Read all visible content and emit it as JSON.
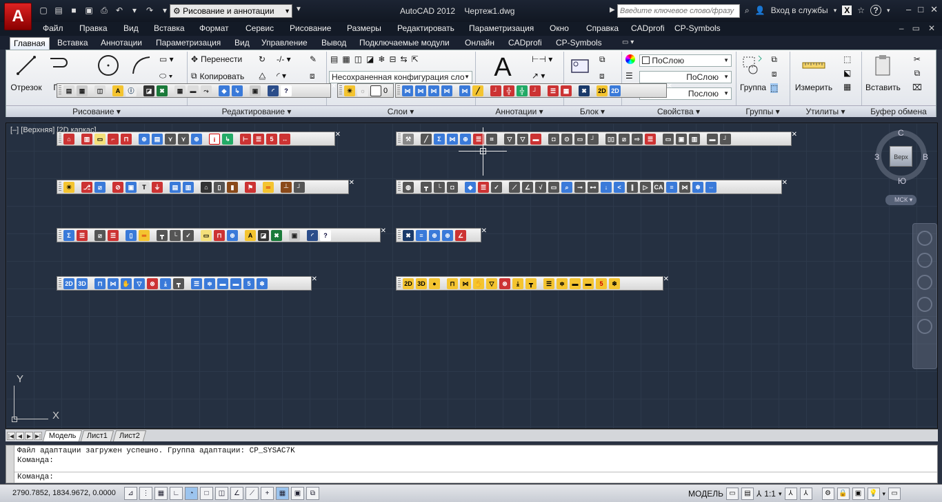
{
  "titlebar": {
    "app_letter": "A",
    "workspace": "Рисование и аннотации",
    "app_title": "AutoCAD 2012",
    "doc_title": "Чертеж1.dwg",
    "search_placeholder": "Введите ключевое слово/фразу",
    "signin": "Вход в службы",
    "help": "?",
    "min": "–",
    "max": "□",
    "close": "✕"
  },
  "menu": [
    "Файл",
    "Правка",
    "Вид",
    "Вставка",
    "Формат",
    "Сервис",
    "Рисование",
    "Размеры",
    "Редактировать",
    "Параметризация",
    "Окно",
    "Справка",
    "CADprofi",
    "CP-Symbols"
  ],
  "ribbon_tabs": [
    "Главная",
    "Вставка",
    "Аннотации",
    "Параметризация",
    "Вид",
    "Управление",
    "Вывод",
    "Подключаемые модули",
    "Онлайн",
    "CADprofi",
    "CP-Symbols"
  ],
  "ribbon": {
    "draw_line": "Отрезок",
    "draw_poly": "По",
    "modify_move": "Перенести",
    "modify_copy": "Копировать",
    "layer_state": "Несохраненная конфигурация сло",
    "text_big": "A",
    "layer_num": "0",
    "prop_color": "ПоСлою",
    "prop_linetype": "ПоСлою",
    "prop_lineweight": "Послою",
    "group": "Группа",
    "measure": "Измерить",
    "paste": "Вставить",
    "panels": [
      "Рисование",
      "Редактирование",
      "Слои",
      "Аннотации",
      "Блок",
      "Свойства",
      "Группы",
      "Утилиты",
      "Буфер обмена"
    ]
  },
  "viewport": {
    "label": "[–] [Верхняя] [2D каркас]",
    "cube_face": "Верх",
    "dir_n": "С",
    "dir_s": "Ю",
    "dir_w": "З",
    "dir_e": "В",
    "ucs_menu": "МСК",
    "ucs_x": "X",
    "ucs_y": "Y"
  },
  "layout_tabs": [
    "Модель",
    "Лист1",
    "Лист2"
  ],
  "command": {
    "line1": "Файл адаптации загружен успешно. Группа адаптации: CP_SYSAC7K",
    "line2": "Команда:",
    "prompt": "Команда:"
  },
  "status": {
    "coords": "2790.7852, 1834.9672, 0.0000",
    "model": "МОДЕЛЬ",
    "scale": "1:1"
  },
  "colors": {
    "accent": "#c41a1a",
    "viewport_bg": "#253041",
    "toolbar_bg": "#e6e6e6"
  }
}
